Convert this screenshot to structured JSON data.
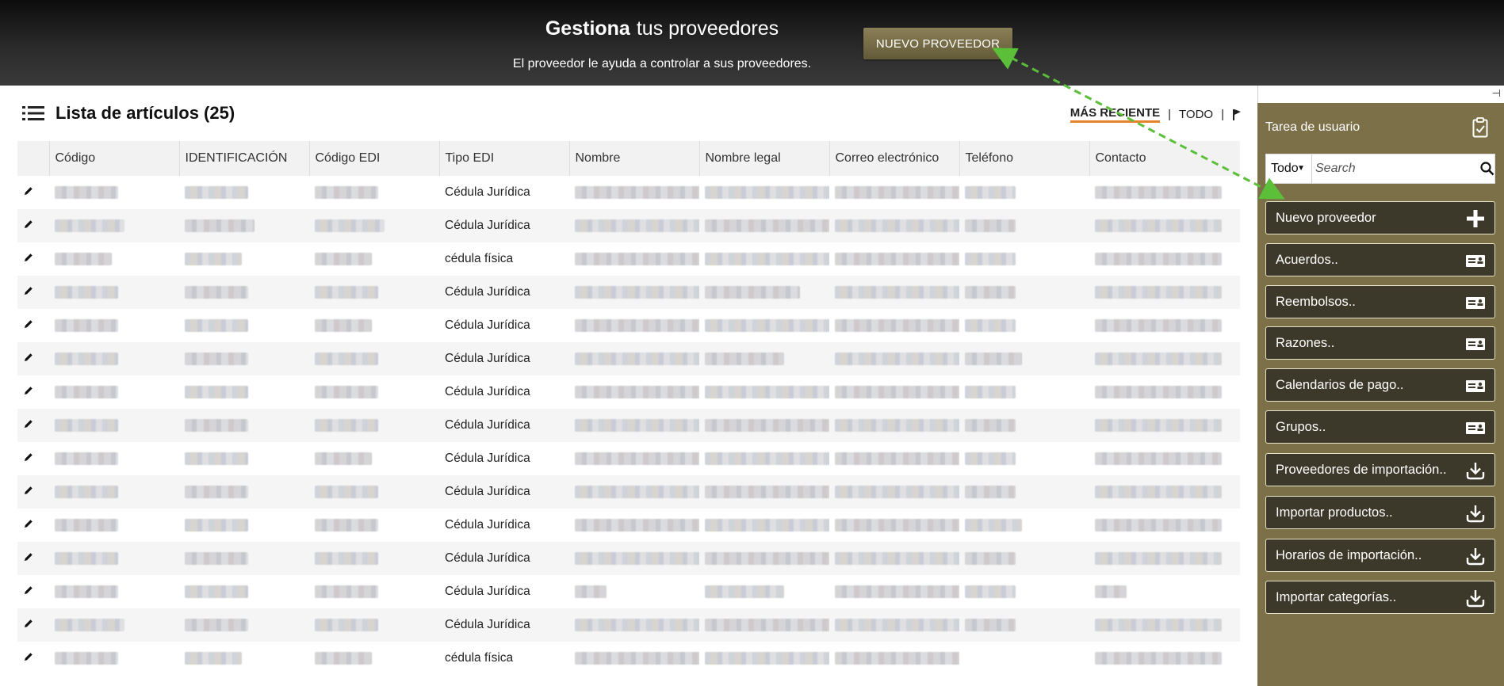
{
  "header": {
    "title_bold": "Gestiona",
    "title_light": "tus proveedores",
    "subtitle": "El proveedor le ayuda a controlar a sus proveedores.",
    "new_button": "NUEVO PROVEEDOR"
  },
  "list": {
    "title": "Lista de artículos (25)",
    "filter_recent": "MÁS RECIENTE",
    "filter_sep": "|",
    "filter_all": "TODO",
    "filter_flag": "|"
  },
  "table": {
    "columns": [
      "",
      "Código",
      "IDENTIFICACIÓN",
      "Código EDI",
      "Tipo EDI",
      "Nombre",
      "Nombre legal",
      "Correo electrónico",
      "Teléfono",
      "Contacto"
    ],
    "rows": [
      {
        "tipo_edi": "Cédula Jurídica"
      },
      {
        "tipo_edi": "Cédula Jurídica"
      },
      {
        "tipo_edi": "cédula física"
      },
      {
        "tipo_edi": "Cédula Jurídica"
      },
      {
        "tipo_edi": "Cédula Jurídica"
      },
      {
        "tipo_edi": "Cédula Jurídica"
      },
      {
        "tipo_edi": "Cédula Jurídica"
      },
      {
        "tipo_edi": "Cédula Jurídica"
      },
      {
        "tipo_edi": "Cédula Jurídica"
      },
      {
        "tipo_edi": "Cédula Jurídica"
      },
      {
        "tipo_edi": "Cédula Jurídica"
      },
      {
        "tipo_edi": "Cédula Jurídica"
      },
      {
        "tipo_edi": "Cédula Jurídica"
      },
      {
        "tipo_edi": "Cédula Jurídica"
      },
      {
        "tipo_edi": "cédula física"
      }
    ]
  },
  "sidebar": {
    "title": "Tarea de usuario",
    "pin_glyph": "⊣",
    "select_value": "Todo",
    "search_placeholder": "Search",
    "tasks": [
      {
        "label": "Nuevo proveedor",
        "icon": "plus-icon"
      },
      {
        "label": "Acuerdos..",
        "icon": "id-card-icon"
      },
      {
        "label": "Reembolsos..",
        "icon": "id-card-icon"
      },
      {
        "label": "Razones..",
        "icon": "id-card-icon"
      },
      {
        "label": "Calendarios de pago..",
        "icon": "id-card-icon"
      },
      {
        "label": "Grupos..",
        "icon": "id-card-icon"
      },
      {
        "label": "Proveedores de importación..",
        "icon": "download-icon"
      },
      {
        "label": "Importar productos..",
        "icon": "download-icon"
      },
      {
        "label": "Horarios de importación..",
        "icon": "download-icon"
      },
      {
        "label": "Importar categorías..",
        "icon": "download-icon"
      }
    ]
  },
  "colors": {
    "sidebar_bg": "#7c7048",
    "task_button_bg": "#3d392a",
    "accent_underline": "#e6822a",
    "annotation_arrow": "#5cbf3a"
  }
}
